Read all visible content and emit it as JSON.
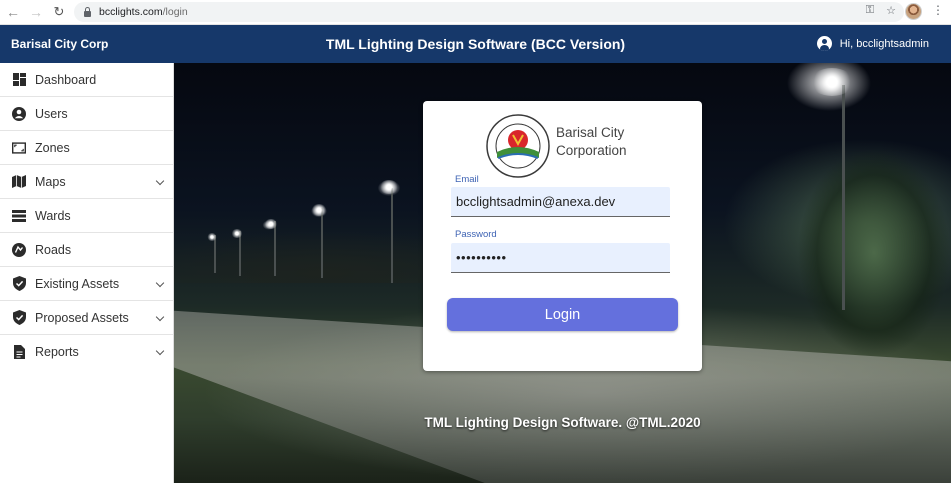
{
  "browser": {
    "url_host": "bcclights.com",
    "url_path": "/login",
    "icons": [
      "back-icon",
      "forward-icon",
      "reload-icon",
      "lock-icon",
      "key-icon",
      "star-icon",
      "profile-avatar",
      "kebab-menu-icon"
    ]
  },
  "header": {
    "brand": "Barisal City Corp",
    "title": "TML Lighting Design Software (BCC Version)",
    "user_greeting": "Hi, bcclightsadmin",
    "background_color": "#16386a"
  },
  "sidebar": {
    "items": [
      {
        "label": "Dashboard",
        "icon": "dashboard-icon",
        "expandable": false
      },
      {
        "label": "Users",
        "icon": "user-circle-icon",
        "expandable": false
      },
      {
        "label": "Zones",
        "icon": "zone-icon",
        "expandable": false
      },
      {
        "label": "Maps",
        "icon": "map-icon",
        "expandable": true
      },
      {
        "label": "Wards",
        "icon": "wards-icon",
        "expandable": false
      },
      {
        "label": "Roads",
        "icon": "roads-icon",
        "expandable": false
      },
      {
        "label": "Existing Assets",
        "icon": "shield-check-icon",
        "expandable": true
      },
      {
        "label": "Proposed Assets",
        "icon": "shield-check-icon",
        "expandable": true
      },
      {
        "label": "Reports",
        "icon": "report-icon",
        "expandable": true
      }
    ]
  },
  "login": {
    "org_line1": "Barisal City",
    "org_line2": "Corporation",
    "email_label": "Email",
    "email_value": "bcclightsadmin@anexa.dev",
    "password_label": "Password",
    "password_value": "••••••••••",
    "button_label": "Login",
    "button_color": "#6470dd"
  },
  "footer": {
    "text": "TML Lighting Design Software. @TML.2020"
  }
}
